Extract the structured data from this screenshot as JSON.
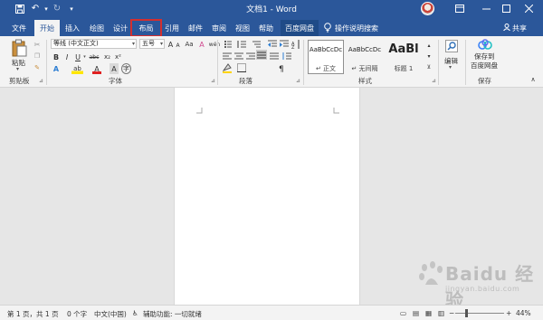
{
  "titlebar": {
    "title": "文档1 - Word",
    "save_icon": "save-icon",
    "undo_icon": "undo-icon",
    "redo_icon": "redo-icon",
    "customize_icon": "customize-icon",
    "window_controls": {
      "ribbon_display": "ribbon-display-icon",
      "minimize": "minimize-icon",
      "maximize": "maximize-icon",
      "close": "close-icon"
    }
  },
  "tabs": [
    {
      "label": "文件"
    },
    {
      "label": "开始",
      "active": true
    },
    {
      "label": "插入"
    },
    {
      "label": "绘图"
    },
    {
      "label": "设计"
    },
    {
      "label": "布局",
      "highlighted": true
    },
    {
      "label": "引用"
    },
    {
      "label": "邮件"
    },
    {
      "label": "审阅"
    },
    {
      "label": "视图"
    },
    {
      "label": "帮助"
    },
    {
      "label": "百度网盘"
    }
  ],
  "tell_me": "操作说明搜索",
  "share": "共享",
  "ribbon": {
    "clipboard": {
      "paste": "粘贴",
      "label": "剪贴板"
    },
    "font": {
      "name": "等线 (中文正文)",
      "size": "五号",
      "label": "字体",
      "size_large": "A",
      "size_small": "A",
      "change_case": "Aa",
      "clear_formatting": "A",
      "phonetic": "wén",
      "bold": "B",
      "italic": "I",
      "underline": "U",
      "strikethrough": "abc",
      "subscript": "x₂",
      "superscript": "x²",
      "text_effects": "A",
      "highlight": "ab",
      "font_color": "A",
      "char_shading": "A",
      "enclose": "字"
    },
    "paragraph": {
      "label": "段落"
    },
    "styles": {
      "label": "样式",
      "items": [
        {
          "sample": "AaBbCcDc",
          "name": "↵ 正文"
        },
        {
          "sample": "AaBbCcDc",
          "name": "↵ 无间隔"
        },
        {
          "sample": "AaBl",
          "name": "标题 1"
        }
      ]
    },
    "editing": {
      "label": "编辑"
    },
    "save": {
      "line1": "保存到",
      "line2": "百度网盘",
      "label": "保存"
    }
  },
  "statusbar": {
    "page": "第 1 页，共 1 页",
    "words": "0 个字",
    "language": "中文(中国)",
    "accessibility": "辅助功能: 一切就绪",
    "zoom_minus": "−",
    "zoom_plus": "+",
    "zoom": "44%",
    "zoom_level": 0.44
  },
  "watermark": {
    "main": "Baidu 经验",
    "url": "jingyan.baidu.com"
  }
}
